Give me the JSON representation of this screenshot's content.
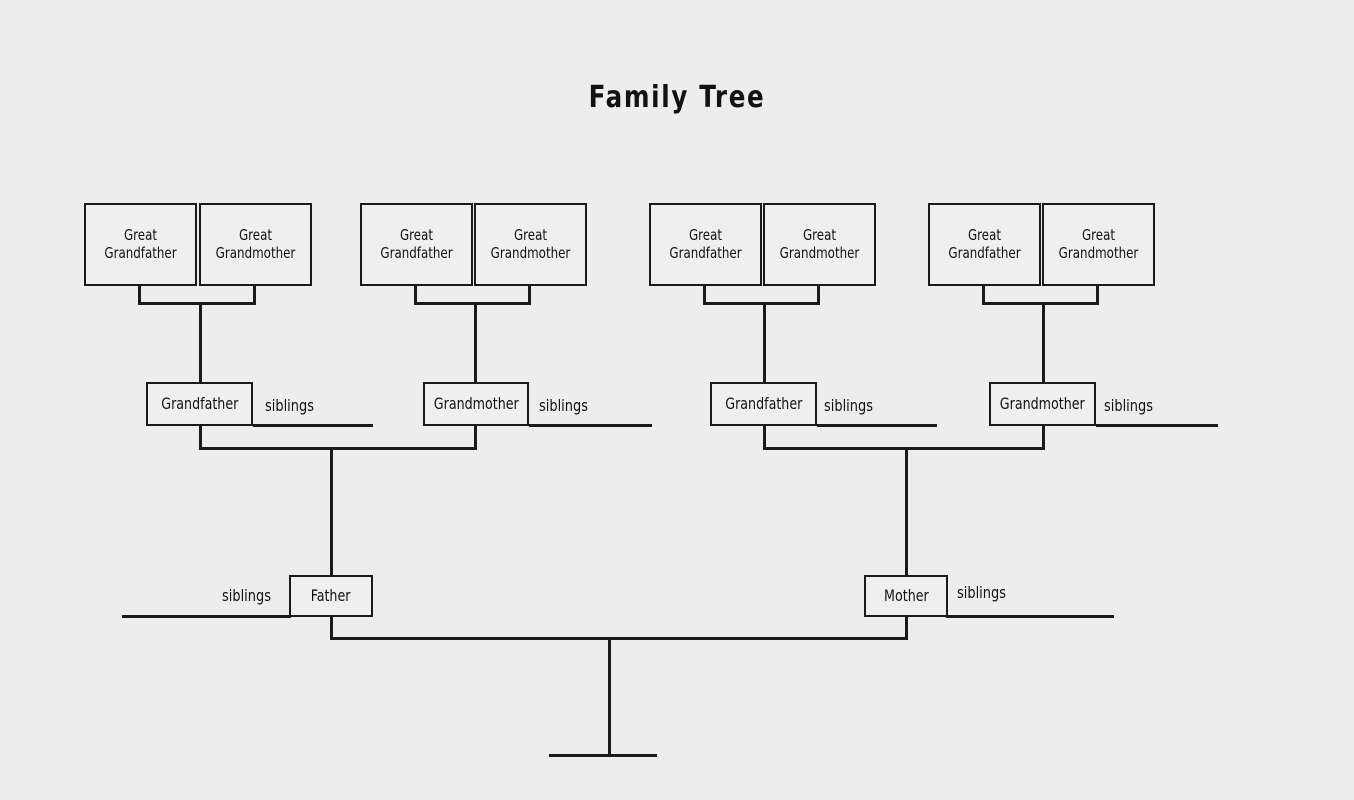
{
  "title": "Family Tree",
  "labels": {
    "great_grandfather": "Great Grandfather",
    "great_grandmother": "Great Grandmother",
    "grandfather": "Grandfather",
    "grandmother": "Grandmother",
    "father": "Father",
    "mother": "Mother",
    "siblings": "siblings"
  },
  "colors": {
    "background": "#ededed",
    "line": "#1a1a1a",
    "box_fill": "#efefef",
    "text": "#111111"
  },
  "chart_data": {
    "type": "diagram",
    "title": "Family Tree",
    "generations": [
      {
        "name": "great-grandparents",
        "nodes": [
          {
            "id": "ggf1",
            "label": "Great Grandfather"
          },
          {
            "id": "ggm1",
            "label": "Great Grandmother"
          },
          {
            "id": "ggf2",
            "label": "Great Grandfather"
          },
          {
            "id": "ggm2",
            "label": "Great Grandmother"
          },
          {
            "id": "ggf3",
            "label": "Great Grandfather"
          },
          {
            "id": "ggm3",
            "label": "Great Grandmother"
          },
          {
            "id": "ggf4",
            "label": "Great Grandfather"
          },
          {
            "id": "ggm4",
            "label": "Great Grandmother"
          }
        ]
      },
      {
        "name": "grandparents",
        "nodes": [
          {
            "id": "gf1",
            "label": "Grandfather",
            "siblings": "siblings"
          },
          {
            "id": "gm1",
            "label": "Grandmother",
            "siblings": "siblings"
          },
          {
            "id": "gf2",
            "label": "Grandfather",
            "siblings": "siblings"
          },
          {
            "id": "gm2",
            "label": "Grandmother",
            "siblings": "siblings"
          }
        ]
      },
      {
        "name": "parents",
        "nodes": [
          {
            "id": "father",
            "label": "Father",
            "siblings": "siblings"
          },
          {
            "id": "mother",
            "label": "Mother",
            "siblings": "siblings"
          }
        ]
      },
      {
        "name": "children",
        "nodes": [
          {
            "id": "child",
            "label": ""
          }
        ]
      }
    ],
    "unions": [
      {
        "partners": [
          "ggf1",
          "ggm1"
        ],
        "child": "gf1"
      },
      {
        "partners": [
          "ggf2",
          "ggm2"
        ],
        "child": "gm1"
      },
      {
        "partners": [
          "ggf3",
          "ggm3"
        ],
        "child": "gf2"
      },
      {
        "partners": [
          "ggf4",
          "ggm4"
        ],
        "child": "gm2"
      },
      {
        "partners": [
          "gf1",
          "gm1"
        ],
        "child": "father"
      },
      {
        "partners": [
          "gf2",
          "gm2"
        ],
        "child": "mother"
      },
      {
        "partners": [
          "father",
          "mother"
        ],
        "child": "child"
      }
    ]
  }
}
